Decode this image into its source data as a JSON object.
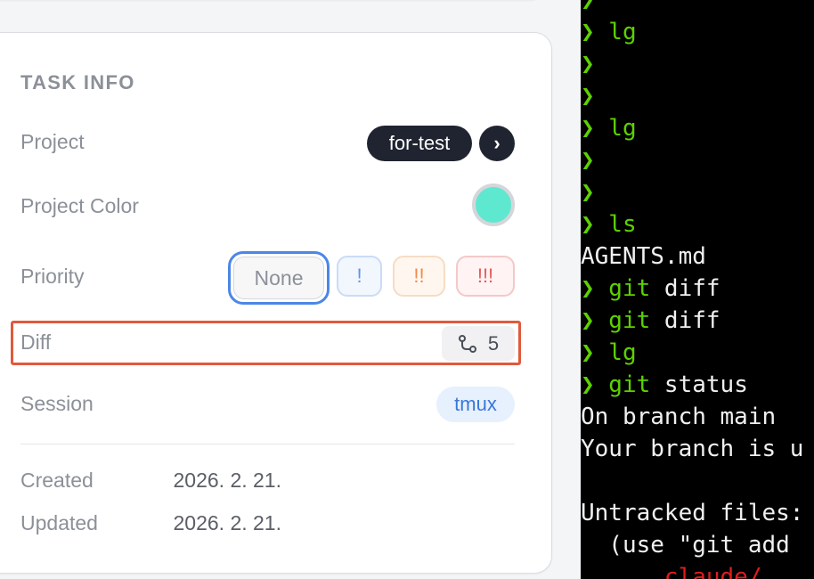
{
  "task_info": {
    "title": "TASK INFO",
    "project": {
      "label": "Project",
      "value": "for-test",
      "arrow": "›"
    },
    "project_color": {
      "label": "Project Color",
      "color": "#5ee8d0"
    },
    "priority": {
      "label": "Priority",
      "options": [
        "None",
        "!",
        "!!",
        "!!!"
      ],
      "selected": "None"
    },
    "diff": {
      "label": "Diff",
      "icon": "git-diff-icon",
      "count": "5"
    },
    "session": {
      "label": "Session",
      "value": "tmux"
    },
    "created": {
      "label": "Created",
      "value": "2026. 2. 21."
    },
    "updated": {
      "label": "Updated",
      "value": "2026. 2. 21."
    }
  },
  "terminal": {
    "prompt": "❯",
    "lines": [
      {
        "prompt": true,
        "cmd": "",
        "rest": ""
      },
      {
        "prompt": true,
        "cmd": "lg",
        "rest": ""
      },
      {
        "prompt": true,
        "cmd": "",
        "rest": ""
      },
      {
        "prompt": true,
        "cmd": "",
        "rest": ""
      },
      {
        "prompt": true,
        "cmd": "lg",
        "rest": ""
      },
      {
        "prompt": true,
        "cmd": "",
        "rest": ""
      },
      {
        "prompt": true,
        "cmd": "",
        "rest": ""
      },
      {
        "prompt": true,
        "cmd": "ls",
        "rest": ""
      },
      {
        "prompt": false,
        "text": "AGENTS.md"
      },
      {
        "prompt": true,
        "cmd": "git",
        "rest": " diff"
      },
      {
        "prompt": true,
        "cmd": "git",
        "rest": " diff"
      },
      {
        "prompt": true,
        "cmd": "lg",
        "rest": ""
      },
      {
        "prompt": true,
        "cmd": "git",
        "rest": " status"
      },
      {
        "prompt": false,
        "text": "On branch main"
      },
      {
        "prompt": false,
        "text": "Your branch is u"
      },
      {
        "prompt": false,
        "text": ""
      },
      {
        "prompt": false,
        "text": "Untracked files:"
      },
      {
        "prompt": false,
        "text": "  (use \"git add"
      },
      {
        "prompt": false,
        "red": "     .claude/"
      }
    ]
  }
}
